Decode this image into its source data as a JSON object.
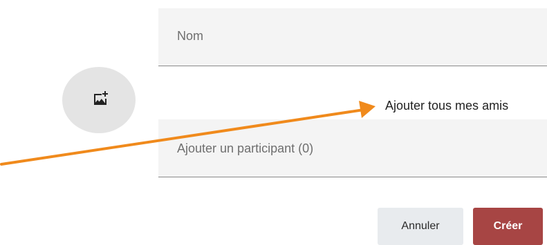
{
  "form": {
    "name_placeholder": "Nom",
    "add_all_friends_label": "Ajouter tous mes amis",
    "participant_placeholder": "Ajouter un participant (0)",
    "avatar_icon": "add-photo-icon"
  },
  "actions": {
    "cancel_label": "Annuler",
    "create_label": "Créer"
  },
  "colors": {
    "create_button": "#a74544",
    "cancel_button": "#e8ebee",
    "field_background": "#f4f4f4",
    "annotation_arrow": "#f08a1c"
  }
}
